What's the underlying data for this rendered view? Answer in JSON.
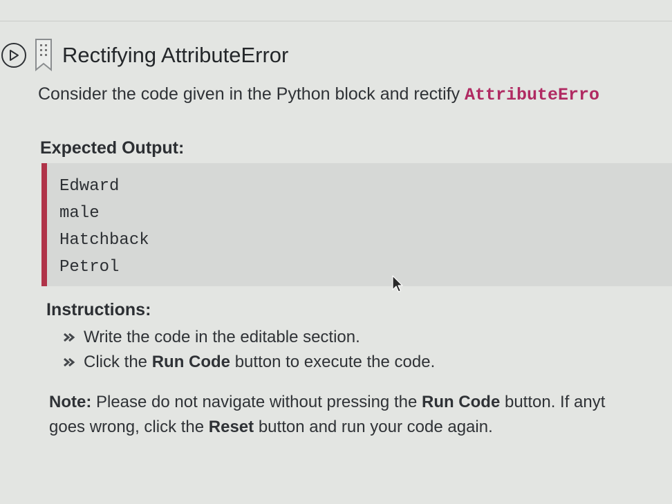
{
  "header": {
    "play_icon": "play-circle-icon",
    "bookmark_icon": "bookmark-icon",
    "title": "Rectifying AttributeError"
  },
  "description": {
    "text": "Consider the code given in the Python block and rectify ",
    "code_term": "AttributeErro"
  },
  "expected_output": {
    "label": "Expected Output:",
    "lines": [
      "Edward",
      "male",
      "Hatchback",
      "Petrol"
    ],
    "accent_color": "#b03349"
  },
  "instructions": {
    "label": "Instructions:",
    "bullet_icon": "double-chevron-right-icon",
    "item1": "Write the code in the editable section.",
    "item2_prefix": "Click the ",
    "item2_bold": "Run Code",
    "item2_suffix": " button to execute the code."
  },
  "note": {
    "label": "Note:",
    "text1": " Please do not navigate without pressing the ",
    "bold1": "Run Code",
    "text2": " button. If anyt",
    "text3": "goes wrong, click the ",
    "bold2": "Reset",
    "text4": " button and run your code again."
  }
}
